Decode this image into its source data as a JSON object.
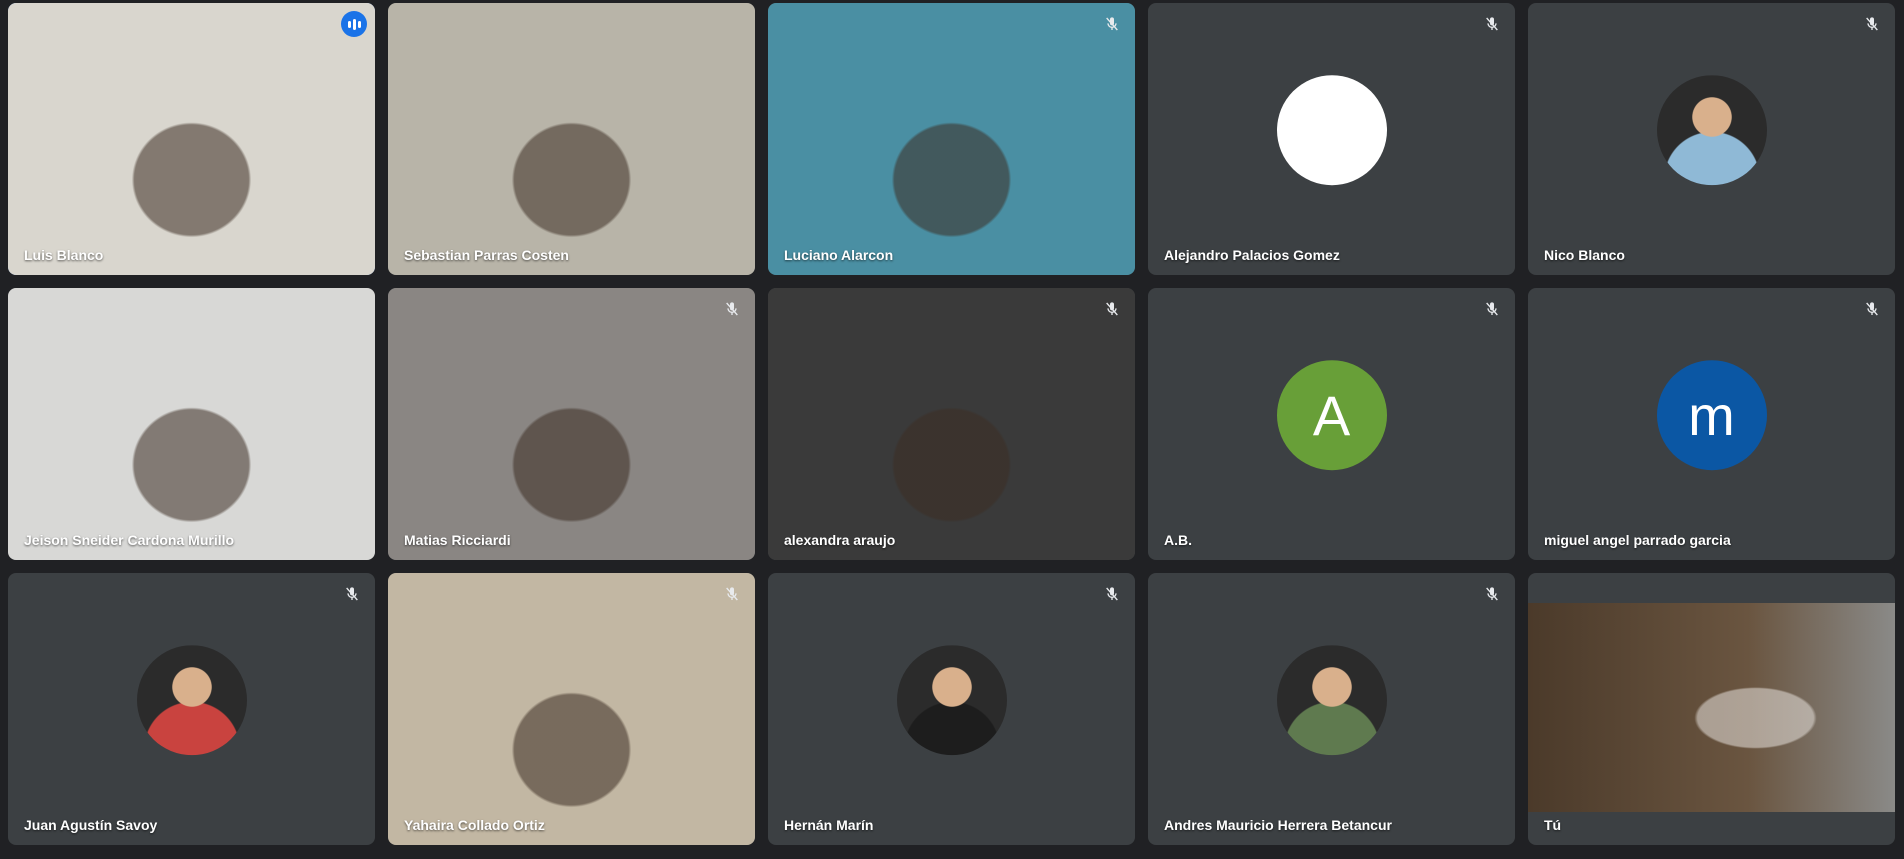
{
  "participants": [
    {
      "name": "Luis Blanco",
      "type": "video",
      "speaking": true,
      "bg": "#d9d6ce"
    },
    {
      "name": "Sebastian Parras Costen",
      "type": "video",
      "muted": false,
      "bg": "#b8b4a8"
    },
    {
      "name": "Luciano Alarcon",
      "type": "video",
      "muted": true,
      "bg": "#4a8fa3"
    },
    {
      "name": "Alejandro Palacios Gomez",
      "type": "avatar",
      "muted": true,
      "avatar_color": "#ffffff",
      "initial": ""
    },
    {
      "name": "Nico Blanco",
      "type": "photo",
      "muted": true,
      "avatar_color": "#8fb9d6"
    },
    {
      "name": "Jeison Sneider Cardona Murillo",
      "type": "video",
      "muted": false,
      "bg": "#d8d8d6"
    },
    {
      "name": "Matias Ricciardi",
      "type": "video",
      "muted": true,
      "bg": "#8a8683"
    },
    {
      "name": "alexandra araujo",
      "type": "video",
      "muted": true,
      "bg": "#3a3a3a"
    },
    {
      "name": "A.B.",
      "type": "avatar",
      "muted": true,
      "avatar_color": "#689f38",
      "initial": "A"
    },
    {
      "name": "miguel angel parrado garcia",
      "type": "avatar",
      "muted": true,
      "avatar_color": "#0b57a4",
      "initial": "m"
    },
    {
      "name": "Juan Agustín Savoy",
      "type": "photo",
      "muted": true,
      "avatar_color": "#c9433f"
    },
    {
      "name": "Yahaira Collado Ortiz",
      "type": "video",
      "muted": true,
      "bg": "#c2b7a3"
    },
    {
      "name": "Hernán Marín",
      "type": "photo",
      "muted": true,
      "avatar_color": "#1d1d1d"
    },
    {
      "name": "Andres Mauricio Herrera Betancur",
      "type": "photo",
      "muted": true,
      "avatar_color": "#5f7a4f"
    },
    {
      "name": "Tú",
      "type": "self",
      "muted": false,
      "bg": "#6a5540"
    }
  ],
  "icons": {
    "mic_off": "mic-off-icon",
    "speaking": "speaking-indicator-icon"
  },
  "colors": {
    "background": "#202124",
    "tile": "#3c4043",
    "active_border": "#4f8bf0",
    "speaking": "#1a73e8"
  }
}
